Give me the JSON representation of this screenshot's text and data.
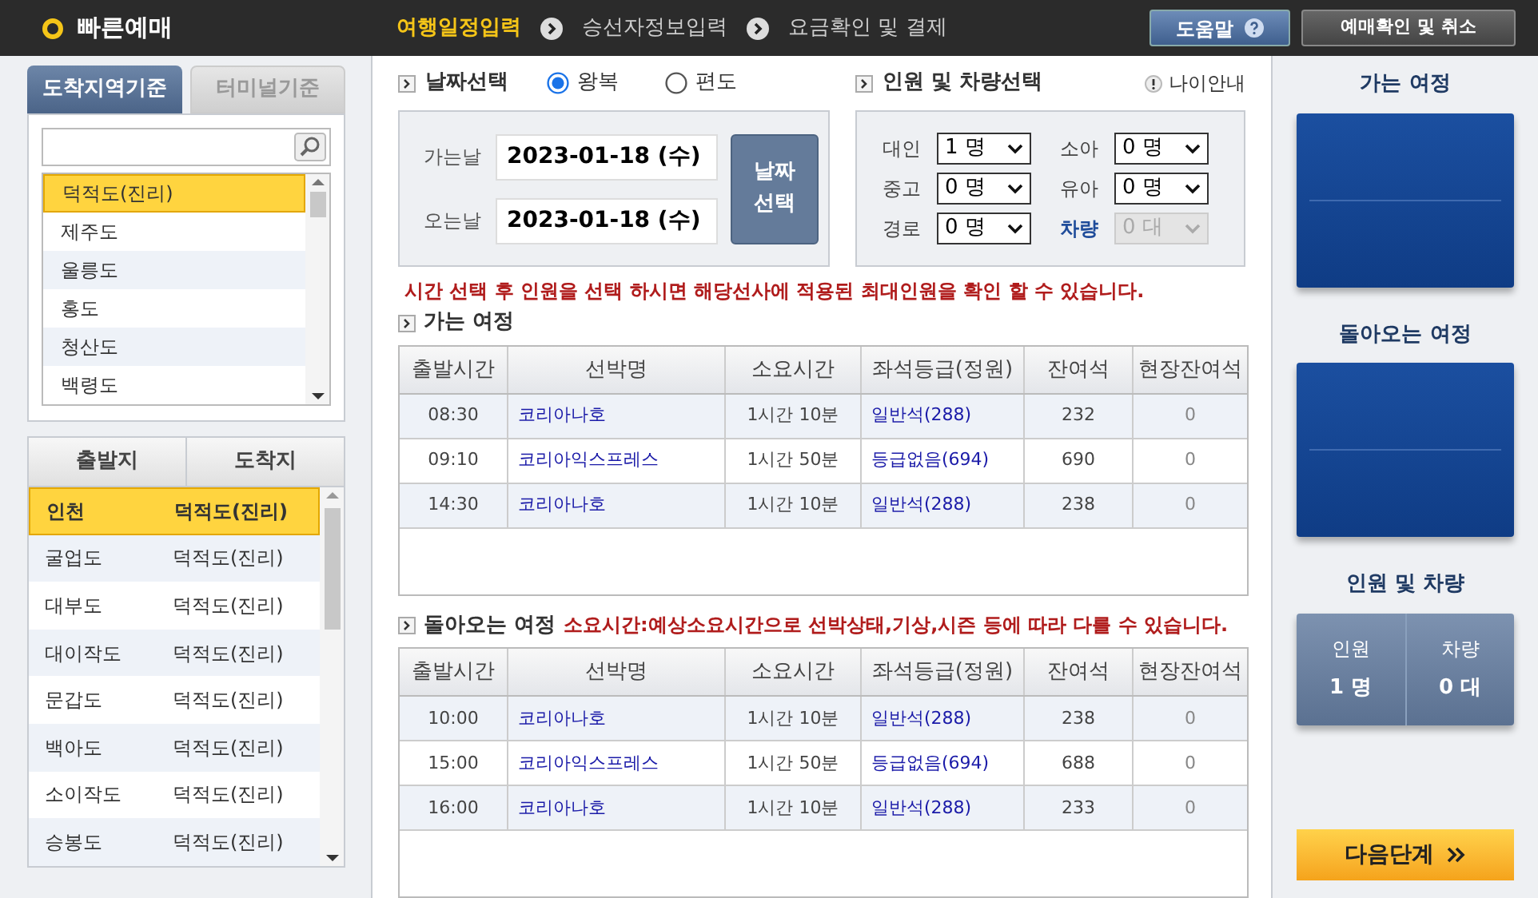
{
  "header": {
    "title": "빠른예매",
    "steps": [
      {
        "label": "여행일정입력",
        "selected": true
      },
      {
        "label": "승선자정보입력",
        "selected": false
      },
      {
        "label": "요금확인 및 결제",
        "selected": false
      }
    ],
    "help_button": "도움말",
    "check_button": "예매확인 및 취소"
  },
  "left": {
    "tabs": [
      {
        "label": "도착지역기준",
        "selected": true
      },
      {
        "label": "터미널기준",
        "selected": false
      }
    ],
    "areas": [
      {
        "label": "덕적도(진리)",
        "selected": true
      },
      {
        "label": "제주도",
        "selected": false
      },
      {
        "label": "울릉도",
        "selected": false
      },
      {
        "label": "홍도",
        "selected": false
      },
      {
        "label": "청산도",
        "selected": false
      },
      {
        "label": "백령도",
        "selected": false
      }
    ],
    "route_columns": [
      "출발지",
      "도착지"
    ],
    "routes": [
      {
        "from": "인천",
        "to": "덕적도(진리)",
        "selected": true
      },
      {
        "from": "굴업도",
        "to": "덕적도(진리)",
        "selected": false
      },
      {
        "from": "대부도",
        "to": "덕적도(진리)",
        "selected": false
      },
      {
        "from": "대이작도",
        "to": "덕적도(진리)",
        "selected": false
      },
      {
        "from": "문갑도",
        "to": "덕적도(진리)",
        "selected": false
      },
      {
        "from": "백아도",
        "to": "덕적도(진리)",
        "selected": false
      },
      {
        "from": "소이작도",
        "to": "덕적도(진리)",
        "selected": false
      },
      {
        "from": "승봉도",
        "to": "덕적도(진리)",
        "selected": false
      }
    ]
  },
  "dates": {
    "title": "날짜선택",
    "trip_types": [
      {
        "label": "왕복",
        "selected": true
      },
      {
        "label": "편도",
        "selected": false
      }
    ],
    "fields": [
      {
        "label": "가는날",
        "value": "2023-01-18 (수)"
      },
      {
        "label": "오는날",
        "value": "2023-01-18 (수)"
      }
    ],
    "button_lines": [
      "날짜",
      "선택"
    ]
  },
  "passengers": {
    "title": "인원 및 차량선택",
    "age_info": "나이안내",
    "fields": [
      {
        "label": "대인",
        "value": "1 명",
        "kind": "person",
        "disabled": false
      },
      {
        "label": "소아",
        "value": "0 명",
        "kind": "person",
        "disabled": false
      },
      {
        "label": "중고",
        "value": "0 명",
        "kind": "person",
        "disabled": false
      },
      {
        "label": "유아",
        "value": "0 명",
        "kind": "person",
        "disabled": false
      },
      {
        "label": "경로",
        "value": "0 명",
        "kind": "person",
        "disabled": false
      },
      {
        "label": "차량",
        "value": "0 대",
        "kind": "vehicle",
        "disabled": true
      }
    ]
  },
  "notice": "시간 선택 후 인원을 선택 하시면 해당선사에 적용된 최대인원을 확인 할 수 있습니다.",
  "outbound": {
    "title": "가는 여정",
    "columns": [
      "출발시간",
      "선박명",
      "소요시간",
      "좌석등급(정원)",
      "잔여석",
      "현장잔여석"
    ],
    "rows": [
      [
        "08:30",
        "코리아나호",
        "1시간 10분",
        "일반석(288)",
        "232",
        "0"
      ],
      [
        "09:10",
        "코리아익스프레스",
        "1시간 50분",
        "등급없음(694)",
        "690",
        "0"
      ],
      [
        "14:30",
        "코리아나호",
        "1시간 10분",
        "일반석(288)",
        "238",
        "0"
      ]
    ]
  },
  "return": {
    "title": "돌아오는 여정",
    "note": "소요시간:예상소요시간으로 선박상태,기상,시즌 등에 따라 다를 수 있습니다.",
    "columns": [
      "출발시간",
      "선박명",
      "소요시간",
      "좌석등급(정원)",
      "잔여석",
      "현장잔여석"
    ],
    "rows": [
      [
        "10:00",
        "코리아나호",
        "1시간 10분",
        "일반석(288)",
        "238",
        "0"
      ],
      [
        "15:00",
        "코리아익스프레스",
        "1시간 50분",
        "등급없음(694)",
        "688",
        "0"
      ],
      [
        "16:00",
        "코리아나호",
        "1시간 10분",
        "일반석(288)",
        "233",
        "0"
      ]
    ]
  },
  "summary": {
    "outbound_title": "가는 여정",
    "return_title": "돌아오는 여정",
    "counts_title": "인원 및 차량",
    "counts": [
      {
        "label": "인원",
        "value": "1 명"
      },
      {
        "label": "차량",
        "value": "0 대"
      }
    ],
    "next_button": "다음단계"
  }
}
